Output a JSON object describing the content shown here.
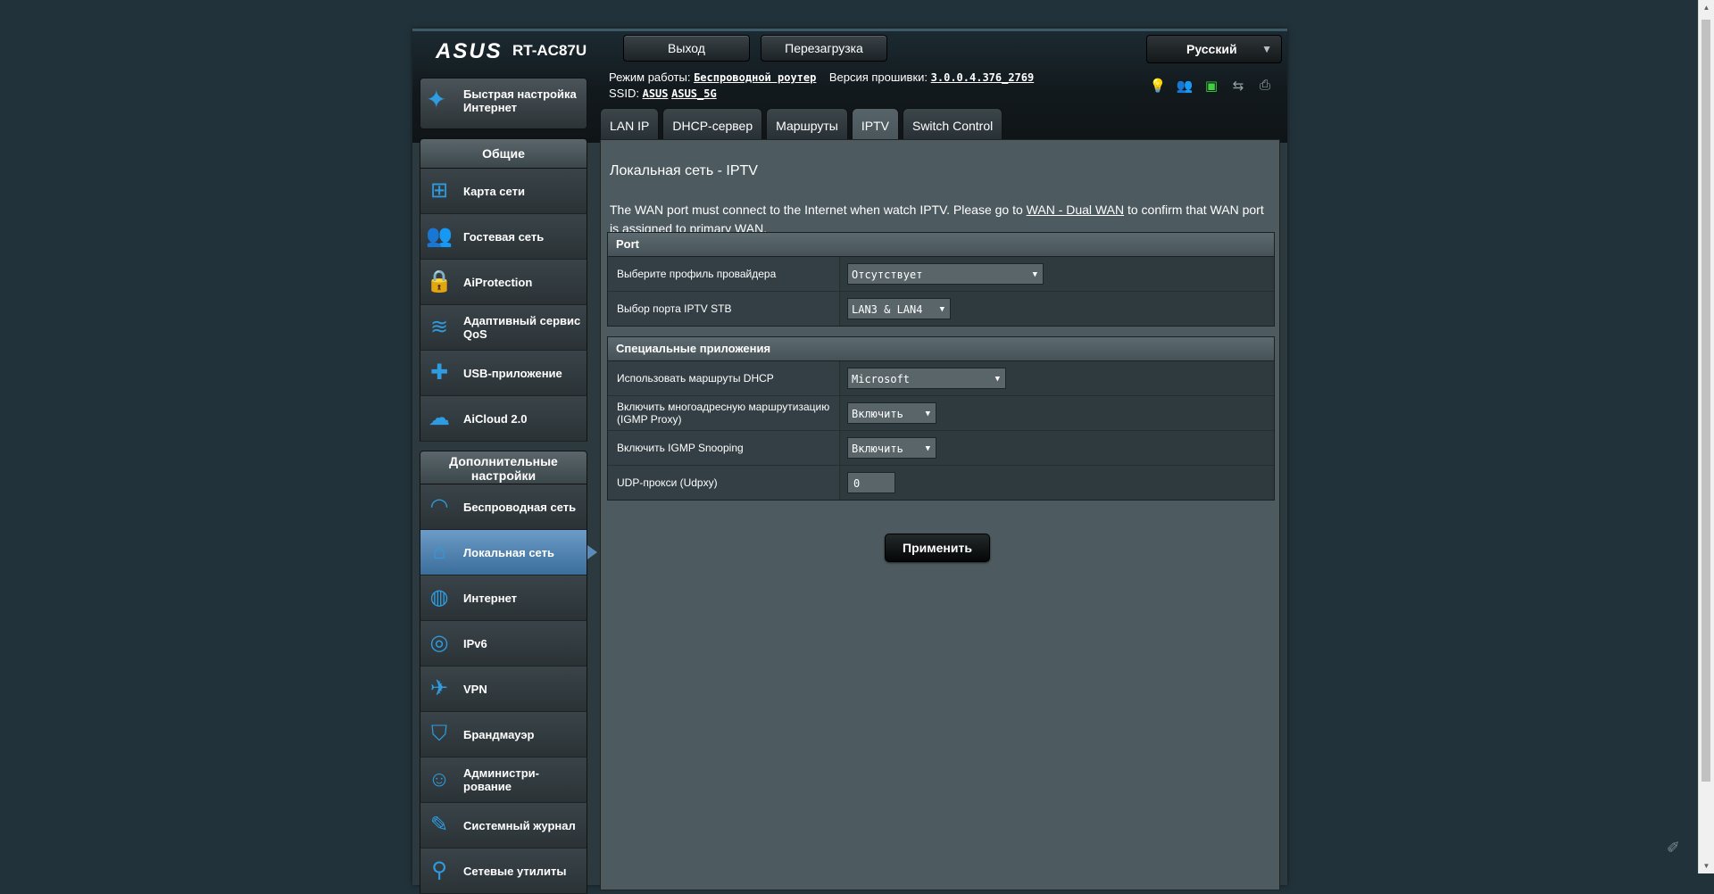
{
  "header": {
    "logo": "/ISUS",
    "model": "RT-AC87U",
    "logout": "Выход",
    "reboot": "Перезагрузка",
    "language": "Русский",
    "mode_label": "Режим работы:",
    "mode_value": "Беспроводной роутер",
    "firmware_label": "Версия прошивки:",
    "firmware_value": "3.0.0.4.376_2769",
    "ssid_label": "SSID:",
    "ssid_1": "ASUS",
    "ssid_2": "ASUS_5G",
    "status_icons": [
      "notification-icon",
      "guest-icon",
      "network-icon",
      "usb-icon",
      "printer-icon"
    ]
  },
  "tabs": [
    "LAN IP",
    "DHCP-сервер",
    "Маршруты",
    "IPTV",
    "Switch Control"
  ],
  "active_tab": "IPTV",
  "sidebar": {
    "quick": "Быстрая настройка Интернет",
    "general_title": "Общие",
    "general": [
      {
        "label": "Карта сети",
        "icon": "network-map-icon"
      },
      {
        "label": "Гостевая сеть",
        "icon": "guest-network-icon"
      },
      {
        "label": "AiProtection",
        "icon": "lock-icon"
      },
      {
        "label": "Адаптивный сервис QoS",
        "icon": "qos-icon"
      },
      {
        "label": "USB-приложение",
        "icon": "puzzle-icon"
      },
      {
        "label": "AiCloud 2.0",
        "icon": "cloud-icon"
      }
    ],
    "advanced_title": "Дополнительные настройки",
    "advanced": [
      {
        "label": "Беспроводная сеть",
        "icon": "wifi-icon"
      },
      {
        "label": "Локальная сеть",
        "icon": "home-icon"
      },
      {
        "label": "Интернет",
        "icon": "globe-icon"
      },
      {
        "label": "IPv6",
        "icon": "ipv6-icon"
      },
      {
        "label": "VPN",
        "icon": "vpn-icon"
      },
      {
        "label": "Брандмауэр",
        "icon": "shield-icon"
      },
      {
        "label": "Администри-рование",
        "icon": "admin-icon"
      },
      {
        "label": "Системный журнал",
        "icon": "log-icon"
      },
      {
        "label": "Сетевые утилиты",
        "icon": "tools-icon"
      }
    ]
  },
  "main": {
    "title": "Локальная сеть - IPTV",
    "desc_before": "The WAN port must connect to the Internet when watch IPTV. Please go to ",
    "desc_link": "WAN - Dual WAN",
    "desc_after": " to confirm that WAN port is assigned to primary WAN.",
    "port_section": "Port",
    "provider_label": "Выберите профиль провайдера",
    "provider_value": "Отсутствует",
    "stb_label": "Выбор порта IPTV STB",
    "stb_value": "LAN3 & LAN4",
    "special_section": "Специальные приложения",
    "dhcp_label": "Использовать маршруты DHCP",
    "dhcp_value": "Microsoft",
    "igmp_proxy_label": "Включить многоадресную маршрутизацию (IGMP Proxy)",
    "igmp_proxy_value": "Включить",
    "igmp_snoop_label": "Включить IGMP Snooping",
    "igmp_snoop_value": "Включить",
    "udpxy_label": "UDP-прокси (Udpxy)",
    "udpxy_value": "0",
    "apply": "Применить"
  }
}
